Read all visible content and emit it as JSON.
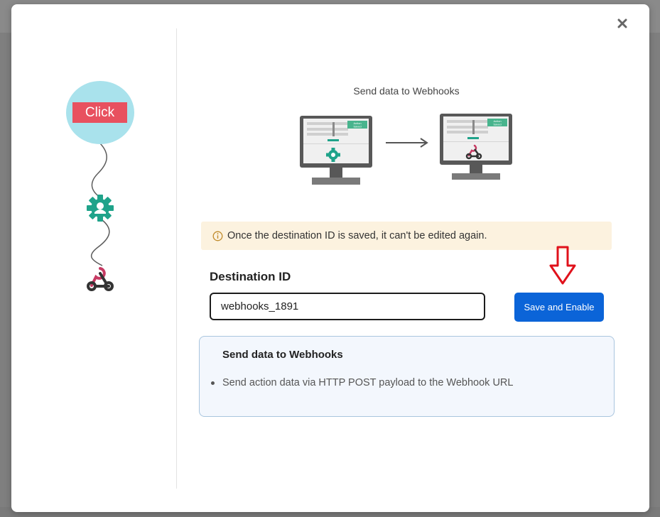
{
  "left_flow": {
    "click_label": "Click"
  },
  "preview": {
    "title": "Send data to Webhooks",
    "monitor_badge_line1": "Action",
    "monitor_badge_line2": "Saved"
  },
  "notice": {
    "text": "Once the destination ID is saved, it can't be edited again."
  },
  "form": {
    "destination_label": "Destination ID",
    "destination_value": "webhooks_1891",
    "save_label": "Save and Enable"
  },
  "info": {
    "title": "Send data to Webhooks",
    "items": [
      "Send action data via HTTP POST payload to the Webhook URL"
    ]
  },
  "colors": {
    "accent_blue": "#0b64d8",
    "gear_teal": "#1fa38a",
    "click_red": "#e8515f",
    "bubble_cyan": "#a9e2ec",
    "notice_bg": "#fcf2df",
    "arrow_red": "#e0111b",
    "webhook_pink": "#c73a63"
  },
  "icons": {
    "close": "close-icon",
    "info": "info-icon",
    "gear": "gear-icon",
    "webhook": "webhook-icon",
    "arrow_down": "arrow-down-icon",
    "arrow_right": "arrow-right-icon"
  }
}
